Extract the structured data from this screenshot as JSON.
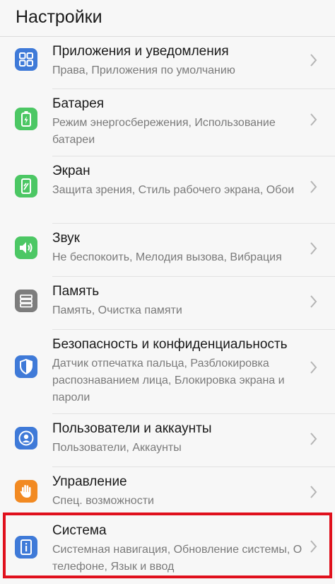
{
  "header": {
    "title": "Настройки"
  },
  "colors": {
    "blue": "#3f7ad8",
    "green": "#4cc764",
    "gray": "#7d7d7d",
    "orange": "#f28a22",
    "highlight": "#e0101c"
  },
  "items": [
    {
      "title": "Приложения и уведомления",
      "subtitle": "Права, Приложения по умолчанию",
      "icon": "apps-grid-icon"
    },
    {
      "title": "Батарея",
      "subtitle": "Режим энергосбережения, Использование батареи",
      "icon": "battery-icon"
    },
    {
      "title": "Экран",
      "subtitle": "Защита зрения, Стиль рабочего экрана, Обои",
      "icon": "display-icon"
    },
    {
      "title": "Звук",
      "subtitle": "Не беспокоить, Мелодия вызова, Вибрация",
      "icon": "sound-icon"
    },
    {
      "title": "Память",
      "subtitle": "Память, Очистка памяти",
      "icon": "storage-icon"
    },
    {
      "title": "Безопасность и конфиденциальность",
      "subtitle": "Датчик отпечатка пальца, Разблокировка распознаванием лица, Блокировка экрана и пароли",
      "icon": "shield-icon"
    },
    {
      "title": "Пользователи и аккаунты",
      "subtitle": "Пользователи, Аккаунты",
      "icon": "user-icon"
    },
    {
      "title": "Управление",
      "subtitle": "Спец. возможности",
      "icon": "hand-icon"
    },
    {
      "title": "Система",
      "subtitle": "Системная навигация, Обновление системы, О телефоне, Язык и ввод",
      "icon": "info-icon"
    }
  ]
}
